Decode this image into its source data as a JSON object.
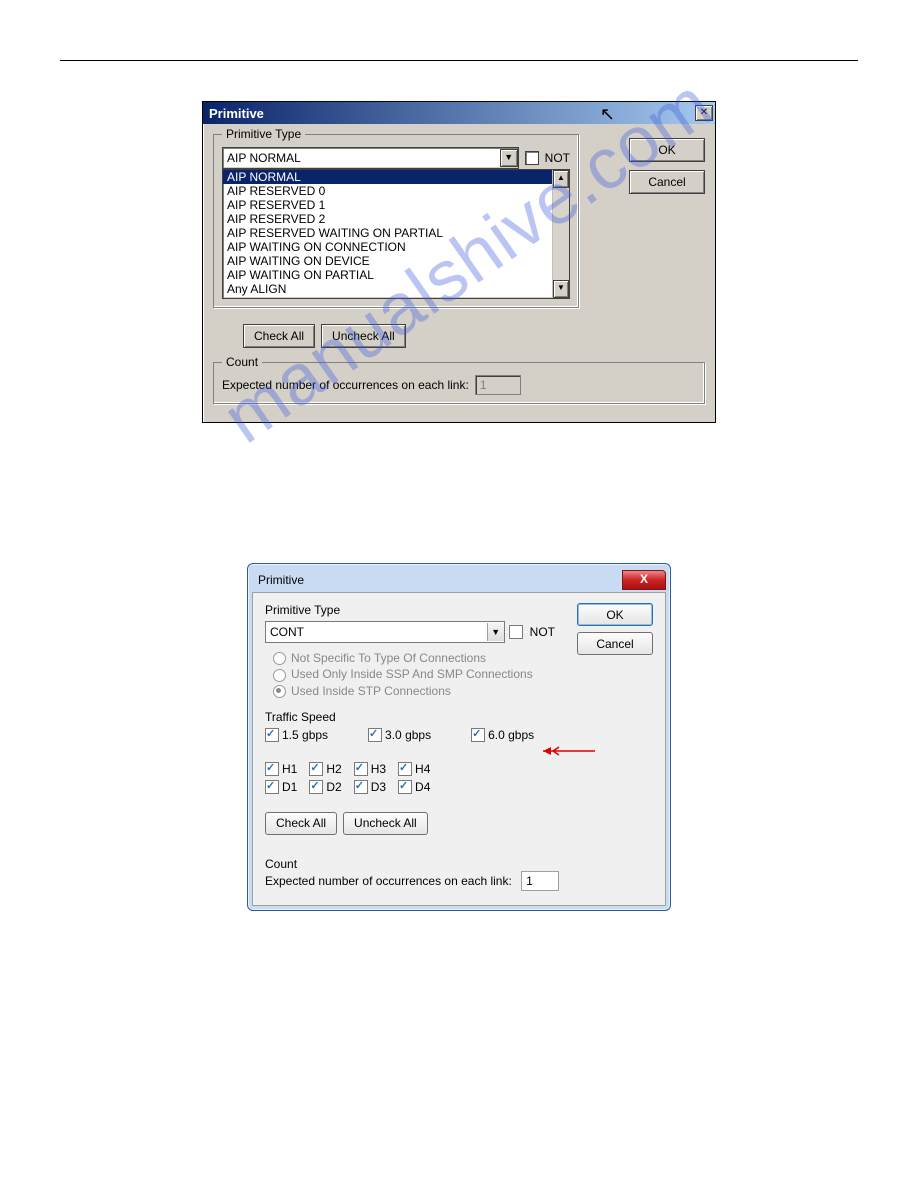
{
  "watermark": "manualshive.com",
  "dlg1": {
    "title": "Primitive",
    "group_primitive": "Primitive Type",
    "combo_value": "AIP NORMAL",
    "not_label": "NOT",
    "list_items": [
      "AIP NORMAL",
      "AIP RESERVED 0",
      "AIP RESERVED 1",
      "AIP RESERVED 2",
      "AIP RESERVED WAITING ON PARTIAL",
      "AIP WAITING ON CONNECTION",
      "AIP WAITING ON DEVICE",
      "AIP WAITING ON PARTIAL",
      "Any ALIGN"
    ],
    "selected_index": 0,
    "ok": "OK",
    "cancel": "Cancel",
    "check_all": "Check All",
    "uncheck_all": "Uncheck All",
    "group_count": "Count",
    "count_label": "Expected number of occurrences on each link:",
    "count_value": "1"
  },
  "dlg2": {
    "title": "Primitive",
    "primitive_type_label": "Primitive Type",
    "combo_value": "CONT",
    "not_label": "NOT",
    "ok": "OK",
    "cancel": "Cancel",
    "radios": [
      "Not Specific To Type Of Connections",
      "Used Only Inside SSP And SMP Connections",
      "Used Inside STP Connections"
    ],
    "radio_selected": 2,
    "traffic_label": "Traffic Speed",
    "speeds": [
      "1.5 gbps",
      "3.0 gbps",
      "6.0 gbps"
    ],
    "h_row": [
      "H1",
      "H2",
      "H3",
      "H4"
    ],
    "d_row": [
      "D1",
      "D2",
      "D3",
      "D4"
    ],
    "check_all": "Check All",
    "uncheck_all": "Uncheck All",
    "count_heading": "Count",
    "count_label": "Expected number of occurrences on each link:",
    "count_value": "1"
  }
}
